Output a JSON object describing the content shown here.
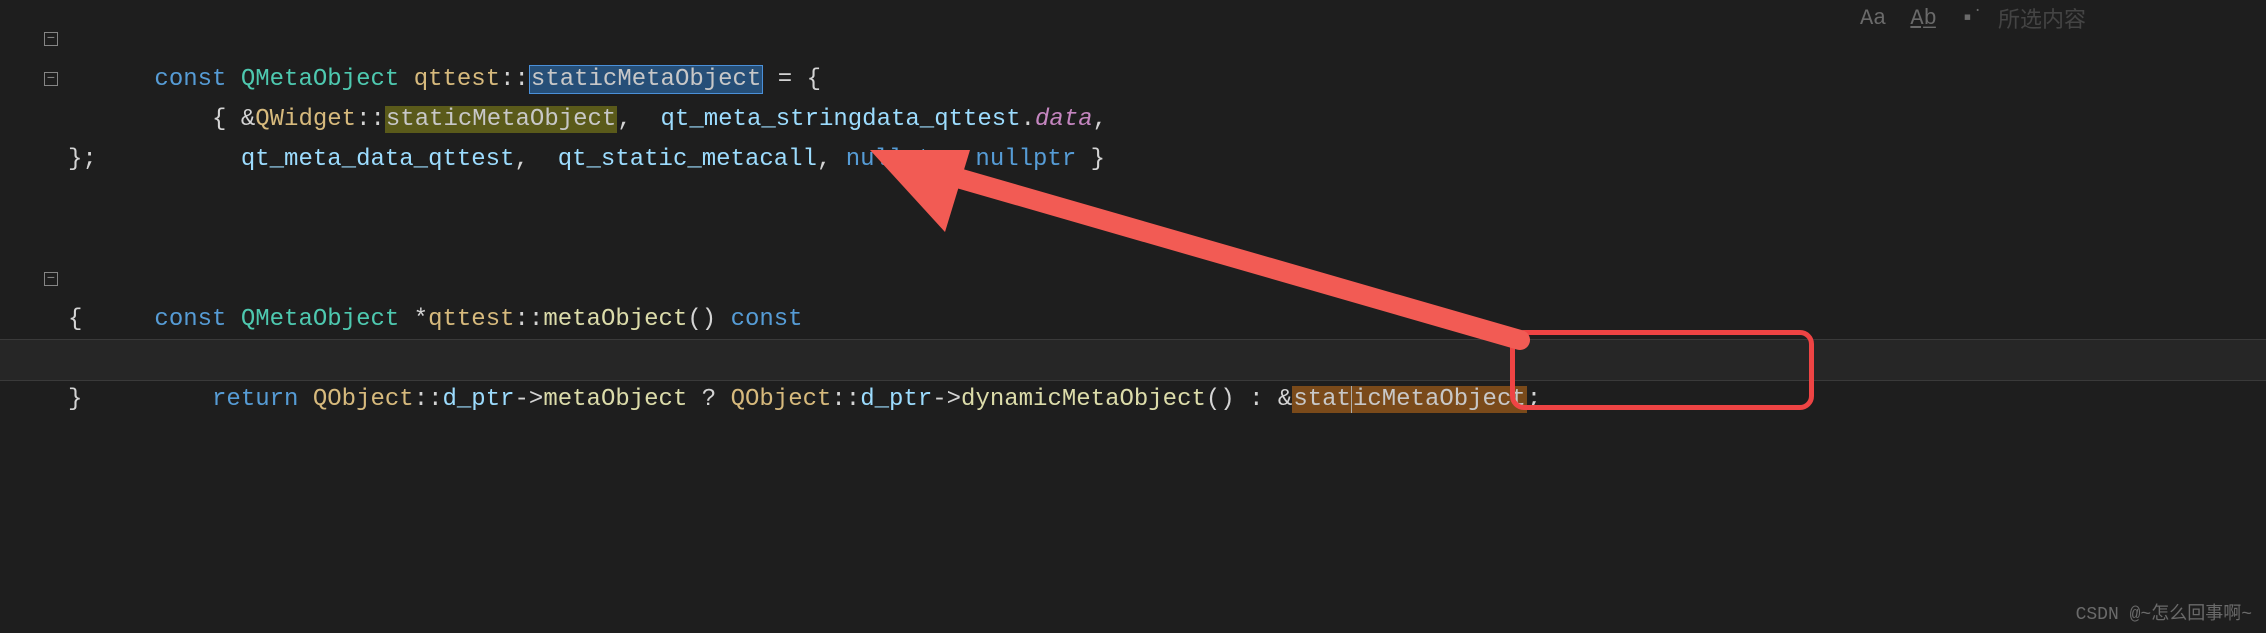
{
  "topbar": {
    "aa": "Aa",
    "ab": "Ab̲",
    "dot": "▪͘",
    "label": "所选内容"
  },
  "code": {
    "l1": {
      "const": "const",
      "type": "QMetaObject",
      "cls": "qttest",
      "scope": "::",
      "member": "staticMetaObject",
      "eq": " = {"
    },
    "l2": {
      "indent": "    ",
      "open": "{ ",
      "amp": "&",
      "cls": "QWidget",
      "scope": "::",
      "member": "staticMetaObject",
      "c1": ",  ",
      "id1": "qt_meta_stringdata_qttest",
      "dot": ".",
      "data": "data",
      "c2": ","
    },
    "l3": {
      "indent": "      ",
      "id1": "qt_meta_data_qttest",
      "c1": ",  ",
      "id2": "qt_static_metacall",
      "c2": ", ",
      "n1": "nullptr",
      "c3": ", ",
      "n2": "nullptr",
      "close": " }"
    },
    "l4": {
      "close": "};"
    },
    "l5": "",
    "l6": "",
    "l7": {
      "const": "const",
      "type": "QMetaObject",
      "star": " *",
      "cls": "qttest",
      "scope": "::",
      "fn": "metaObject",
      "paren": "()",
      "const2": " const"
    },
    "l8": {
      "open": "{"
    },
    "l9": {
      "indent": "    ",
      "ret": "return",
      "sp": " ",
      "cls": "QObject",
      "scope": "::",
      "dptr": "d_ptr",
      "arrow": "->",
      "mo": "metaObject",
      "q": " ? ",
      "cls2": "QObject",
      "scope2": "::",
      "dptr2": "d_ptr",
      "arrow2": "->",
      "dmo": "dynamicMetaObject",
      "paren": "()",
      "colon": " : ",
      "amp": "&",
      "smo1": "stat",
      "smo2": "icMetaObject",
      "semi": ";"
    },
    "l10": {
      "close": "}"
    }
  },
  "watermark": "CSDN @~怎么回事啊~"
}
